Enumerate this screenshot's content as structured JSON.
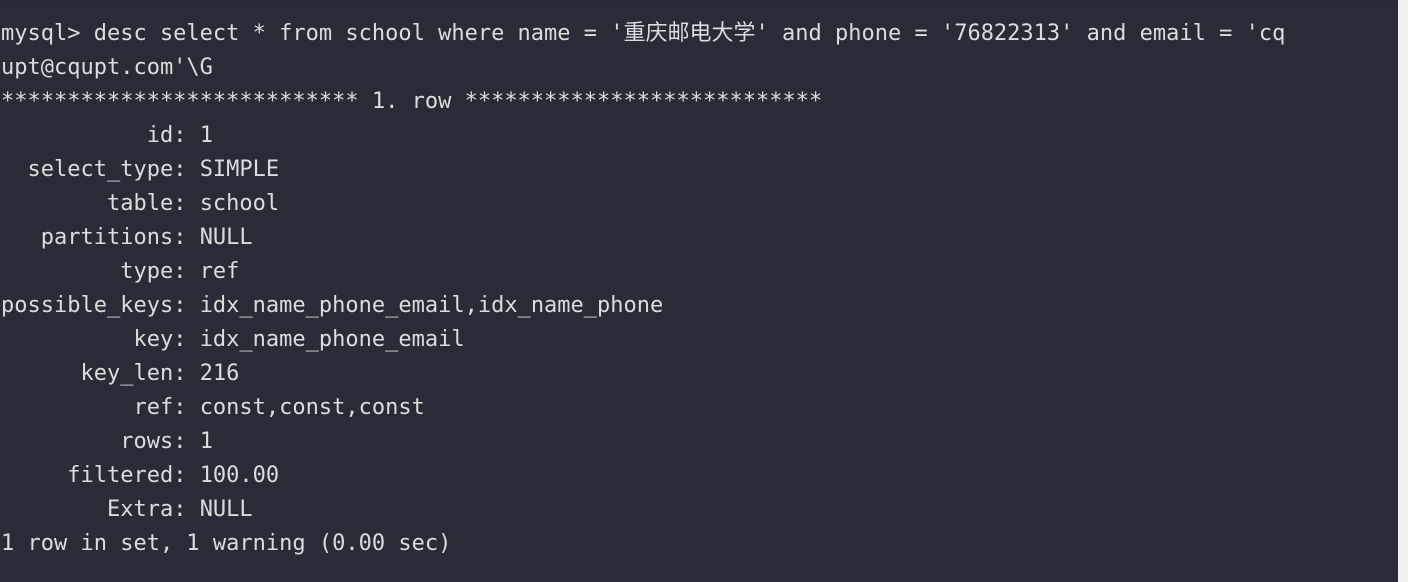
{
  "terminal": {
    "app": "mysql-client",
    "background_color": "#282c37",
    "text_color": "#dcdcdc",
    "prompt": "mysql>",
    "command": "desc select * from school where name = '重庆邮电大学' and phone = '76822313' and email = 'cqupt@cqupt.com'\\G",
    "command_line_1": "mysql> desc select * from school where name = '重庆邮电大学' and phone = '76822313' and email = 'cq",
    "command_line_2": "upt@cqupt.com'\\G",
    "row_separator": "*************************** 1. row ***************************",
    "row_separator_label": "1. row",
    "result_footer": "1 row in set, 1 warning (0.00 sec)"
  },
  "explain_row": {
    "index": 1,
    "fields": [
      {
        "label": "id",
        "padded_label": "           id",
        "value": "1"
      },
      {
        "label": "select_type",
        "padded_label": "  select_type",
        "value": "SIMPLE"
      },
      {
        "label": "table",
        "padded_label": "        table",
        "value": "school"
      },
      {
        "label": "partitions",
        "padded_label": "   partitions",
        "value": "NULL"
      },
      {
        "label": "type",
        "padded_label": "         type",
        "value": "ref"
      },
      {
        "label": "possible_keys",
        "padded_label": "possible_keys",
        "value": "idx_name_phone_email,idx_name_phone"
      },
      {
        "label": "key",
        "padded_label": "          key",
        "value": "idx_name_phone_email"
      },
      {
        "label": "key_len",
        "padded_label": "      key_len",
        "value": "216"
      },
      {
        "label": "ref",
        "padded_label": "          ref",
        "value": "const,const,const"
      },
      {
        "label": "rows",
        "padded_label": "         rows",
        "value": "1"
      },
      {
        "label": "filtered",
        "padded_label": "     filtered",
        "value": "100.00"
      },
      {
        "label": "Extra",
        "padded_label": "        Extra",
        "value": "NULL"
      }
    ]
  },
  "query_conditions": {
    "table": "school",
    "name": "重庆邮电大学",
    "phone": "76822313",
    "email": "cqupt@cqupt.com"
  }
}
